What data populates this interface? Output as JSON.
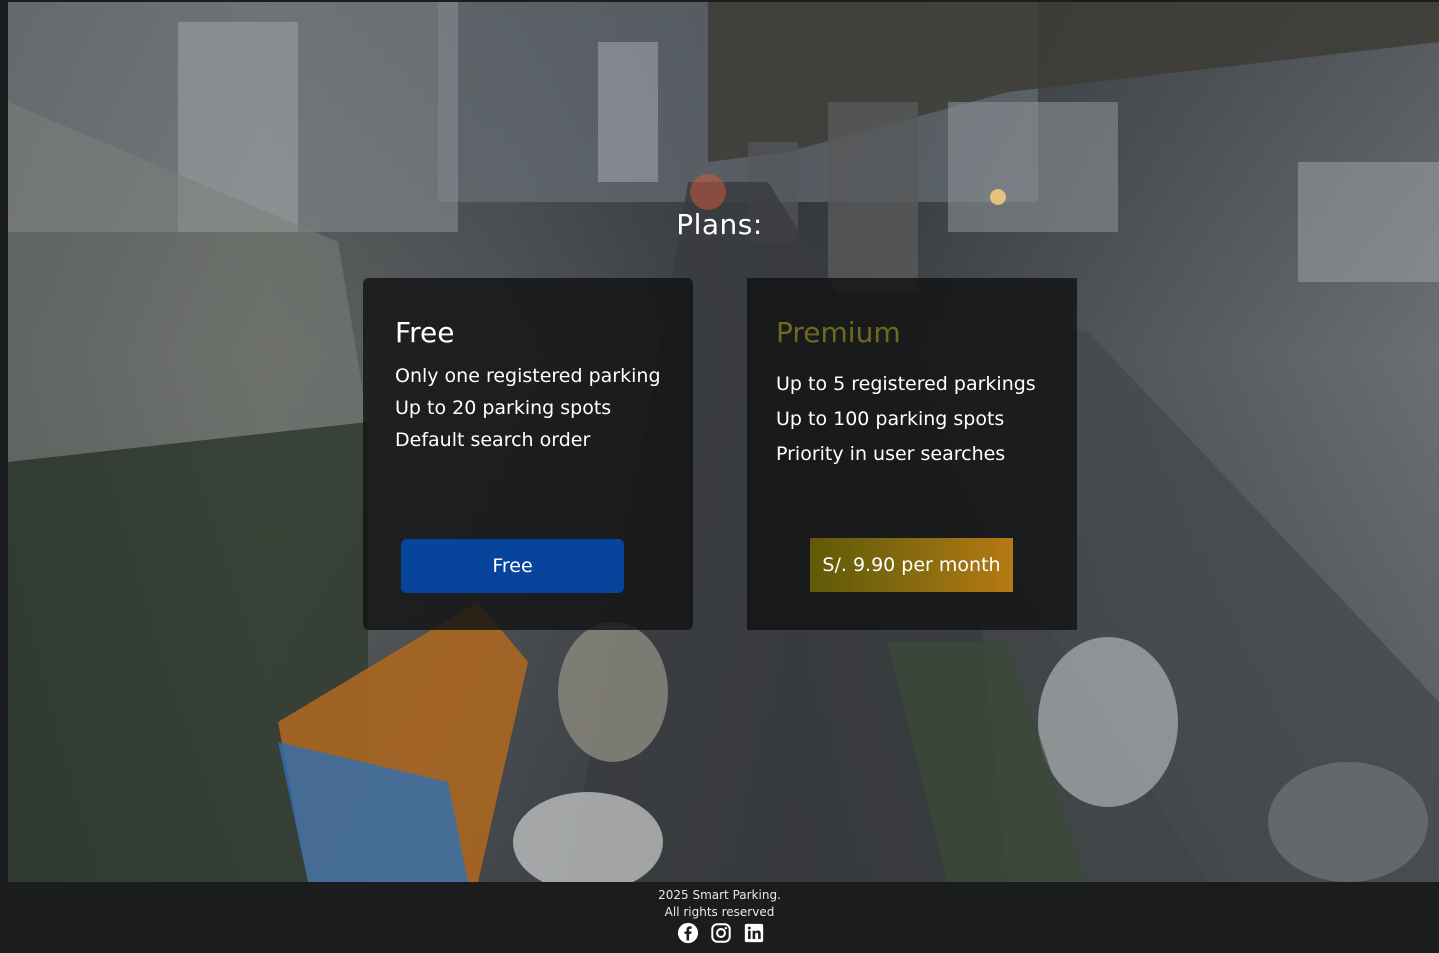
{
  "plans": {
    "heading": "Plans:",
    "free": {
      "title": "Free",
      "features": [
        "Only one registered parking",
        "Up to 20 parking spots",
        "Default search order"
      ],
      "button_label": "Free"
    },
    "premium": {
      "title": "Premium",
      "features": [
        "Up to 5 registered parkings",
        "Up to 100 parking spots",
        "Priority in user searches"
      ],
      "button_label": "S/. 9.90 per month"
    }
  },
  "footer": {
    "copyright_line1": "2025 Smart Parking.",
    "copyright_line2": "All rights reserved",
    "social_icons": [
      "facebook-icon",
      "instagram-icon",
      "linkedin-icon"
    ]
  },
  "colors": {
    "free_button": "#07449c",
    "premium_title": "#6e6a1c",
    "premium_button_start": "#5f5a08",
    "premium_button_end": "#b57a12",
    "footer_bg": "#1b1c1e"
  }
}
